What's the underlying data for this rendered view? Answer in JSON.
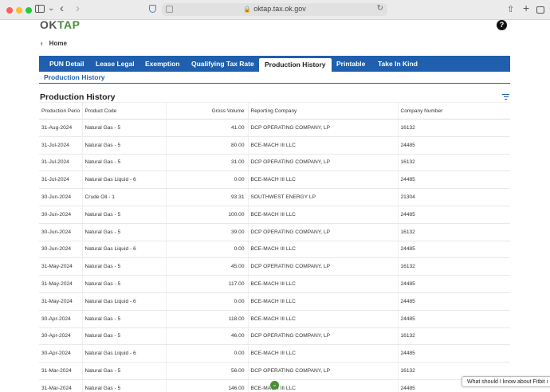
{
  "browser": {
    "url": "oktap.tax.ok.gov"
  },
  "header": {
    "logo_ok": "OK",
    "logo_tap": "TAP",
    "help_label": "?",
    "home_label": "Home"
  },
  "tabs": [
    {
      "label": "PUN Detail"
    },
    {
      "label": "Lease Legal"
    },
    {
      "label": "Exemption"
    },
    {
      "label": "Qualifying Tax Rate"
    },
    {
      "label": "Production History"
    },
    {
      "label": "Printable"
    },
    {
      "label": "Take In Kind"
    }
  ],
  "active_tab": "Production History",
  "subtab": "Production History",
  "section_title": "Production History",
  "table": {
    "columns": [
      "Production Perio",
      "Product Code",
      "Gross Volume",
      "Reporting Company",
      "Company Number"
    ],
    "rows": [
      [
        "31-Aug-2024",
        "Natural Gas - 5",
        "41.00",
        "DCP OPERATING COMPANY, LP",
        "16132"
      ],
      [
        "31-Jul-2024",
        "Natural Gas - 5",
        "80.00",
        "BCE-MACH III LLC",
        "24485"
      ],
      [
        "31-Jul-2024",
        "Natural Gas - 5",
        "31.00",
        "DCP OPERATING COMPANY, LP",
        "16132"
      ],
      [
        "31-Jul-2024",
        "Natural Gas Liquid - 6",
        "0.00",
        "BCE-MACH III LLC",
        "24485"
      ],
      [
        "30-Jun-2024",
        "Crude Oil - 1",
        "93.31",
        "SOUTHWEST ENERGY LP",
        "21304"
      ],
      [
        "30-Jun-2024",
        "Natural Gas - 5",
        "100.00",
        "BCE-MACH III LLC",
        "24485"
      ],
      [
        "30-Jun-2024",
        "Natural Gas - 5",
        "39.00",
        "DCP OPERATING COMPANY, LP",
        "16132"
      ],
      [
        "30-Jun-2024",
        "Natural Gas Liquid - 6",
        "0.00",
        "BCE-MACH III LLC",
        "24485"
      ],
      [
        "31-May-2024",
        "Natural Gas - 5",
        "45.00",
        "DCP OPERATING COMPANY, LP",
        "16132"
      ],
      [
        "31-May-2024",
        "Natural Gas - 5",
        "117.00",
        "BCE-MACH III LLC",
        "24485"
      ],
      [
        "31-May-2024",
        "Natural Gas Liquid - 6",
        "0.00",
        "BCE-MACH III LLC",
        "24485"
      ],
      [
        "30-Apr-2024",
        "Natural Gas - 5",
        "118.00",
        "BCE-MACH III LLC",
        "24485"
      ],
      [
        "30-Apr-2024",
        "Natural Gas - 5",
        "46.00",
        "DCP OPERATING COMPANY, LP",
        "16132"
      ],
      [
        "30-Apr-2024",
        "Natural Gas Liquid - 6",
        "0.00",
        "BCE-MACH III LLC",
        "24485"
      ],
      [
        "31-Mar-2024",
        "Natural Gas - 5",
        "56.00",
        "DCP OPERATING COMPANY, LP",
        "16132"
      ],
      [
        "31-Mar-2024",
        "Natural Gas - 5",
        "146.00",
        "BCE-MACH III LLC",
        "24485"
      ]
    ]
  },
  "chat_prompt": "What should I know about Fitbit i",
  "colors": {
    "brand_blue": "#1f5fad",
    "brand_green": "#4a8d3a"
  }
}
